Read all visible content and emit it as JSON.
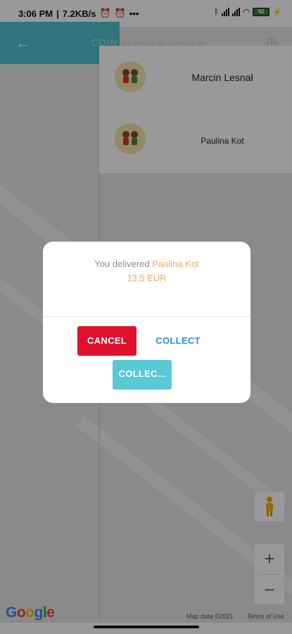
{
  "status_bar": {
    "time": "3:06 PM",
    "speed": "7.2KB/s",
    "more": "•••",
    "battery": "92"
  },
  "app_bar": {
    "title": "COIN SERVICE ORDER"
  },
  "people": [
    {
      "name": "Marcin Lesnał"
    },
    {
      "name": "Paulina Kot"
    }
  ],
  "map": {
    "logo": "Google",
    "map_data": "Map data ©2021",
    "terms": "Terms of Use"
  },
  "zoom": {
    "in": "+",
    "out": "−"
  },
  "dialog": {
    "message_prefix": "You delivered ",
    "recipient": "Paulina Kot",
    "amount": "13.5 EUR",
    "cancel_label": "CANCEL",
    "collect_label": "COLLECT",
    "collect_short_label": "COLLEC..."
  },
  "colors": {
    "accent": "#53c4cf",
    "cancel_red": "#e0102f",
    "link_blue": "#2b8fd9",
    "highlight_orange": "#f4a96a"
  }
}
